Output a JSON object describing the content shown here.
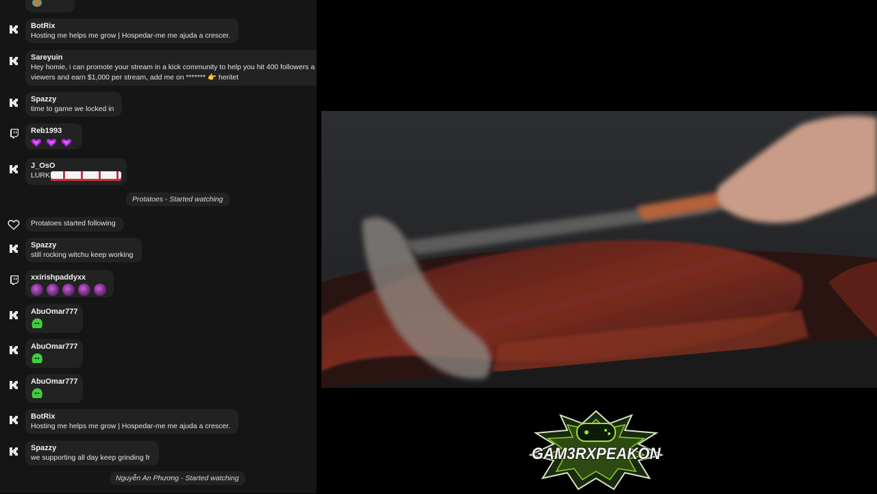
{
  "chat": {
    "messages": [
      {
        "platform": "kick",
        "user": "BotRix",
        "text": "Hosting me helps me grow | Hospedar-me me ajuda a crescer."
      },
      {
        "platform": "kick",
        "user": "Sareyuin",
        "line1": "Hey homie, i can promote your stream in a kick community to help you hit 400 followers a",
        "line2": "viewers and earn $1,000 per stream, add me on ******* 👉 heritet"
      },
      {
        "platform": "kick",
        "user": "Spazzy",
        "text": "time to game we locked in"
      },
      {
        "platform": "twitch",
        "user": "Reb1993",
        "emote": "purple-heart-emotes"
      },
      {
        "platform": "kick",
        "user": "J_OsO",
        "text": "LURK",
        "emote": "lurk-car-emotes"
      },
      {
        "platform": "kick",
        "user": "Spazzy",
        "text": "still rocking witchu keep working"
      },
      {
        "platform": "twitch",
        "user": "xxirishpaddyxx",
        "emote": "purple-ball-emotes"
      },
      {
        "platform": "kick",
        "user": "AbuOmar777",
        "emote": "green-blob-emote"
      },
      {
        "platform": "kick",
        "user": "AbuOmar777",
        "emote": "green-blob-emote"
      },
      {
        "platform": "kick",
        "user": "AbuOmar777",
        "emote": "green-blob-emote"
      },
      {
        "platform": "kick",
        "user": "BotRix",
        "text": "Hosting me helps me grow | Hospedar-me me ajuda a crescer."
      },
      {
        "platform": "kick",
        "user": "Spazzy",
        "text": "we supporting all day keep grinding fr"
      }
    ],
    "system": {
      "watch1": "Protatoes - Started watching",
      "follow": "Protatoes started following",
      "watch2": "Nguyễn An Phương - Started watching"
    }
  },
  "logo": {
    "text": "GAM3RXPEAKON"
  },
  "colors": {
    "chat_bg": "#151515",
    "bubble_bg": "#222222",
    "emote_purple": "#b52be0",
    "emote_green": "#3fcf3a"
  }
}
